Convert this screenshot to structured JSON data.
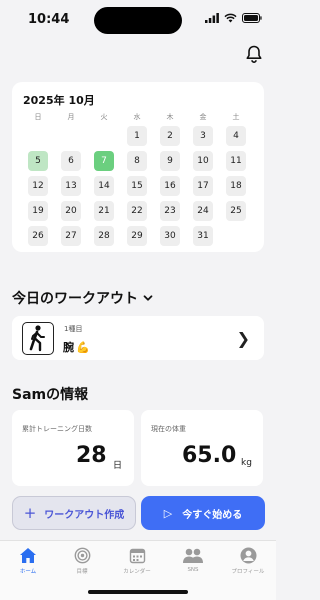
{
  "status_bar": {
    "time": "10:44"
  },
  "calendar": {
    "title": "2025年 10月",
    "weekdays": [
      "日",
      "月",
      "火",
      "水",
      "木",
      "金",
      "土"
    ],
    "first_weekday_index": 3,
    "days_in_month": 31,
    "completed_days": [
      5,
      7
    ],
    "today": 7
  },
  "today_workout": {
    "heading": "今日のワークアウト",
    "subtitle": "1種目",
    "name": "腕",
    "name_emoji": "💪",
    "chevron": "❯"
  },
  "user_info": {
    "heading": "Samの情報",
    "training_days": {
      "label": "累計トレーニング日数",
      "value": "28",
      "unit": "日"
    },
    "weight": {
      "label": "現在の体重",
      "value": "65.0",
      "unit": "kg"
    }
  },
  "actions": {
    "create_workout": {
      "icon": "+",
      "label": "ワークアウト作成"
    },
    "start_now": {
      "icon": "▷",
      "label": "今すぐ始める"
    }
  },
  "tab_bar": {
    "accent": "#2a6ef0",
    "items": [
      {
        "label": "ホーム",
        "icon": "home-icon",
        "active": true
      },
      {
        "label": "目標",
        "icon": "target-icon",
        "active": false
      },
      {
        "label": "カレンダー",
        "icon": "calendar-icon",
        "active": false
      },
      {
        "label": "SNS",
        "icon": "people-icon",
        "active": false
      },
      {
        "label": "プロフィール",
        "icon": "profile-icon",
        "active": false
      }
    ]
  },
  "colors": {
    "accent_blue": "#3f6ef5",
    "today_green": "#6bcf7f",
    "done_green": "#bfe6c4"
  }
}
